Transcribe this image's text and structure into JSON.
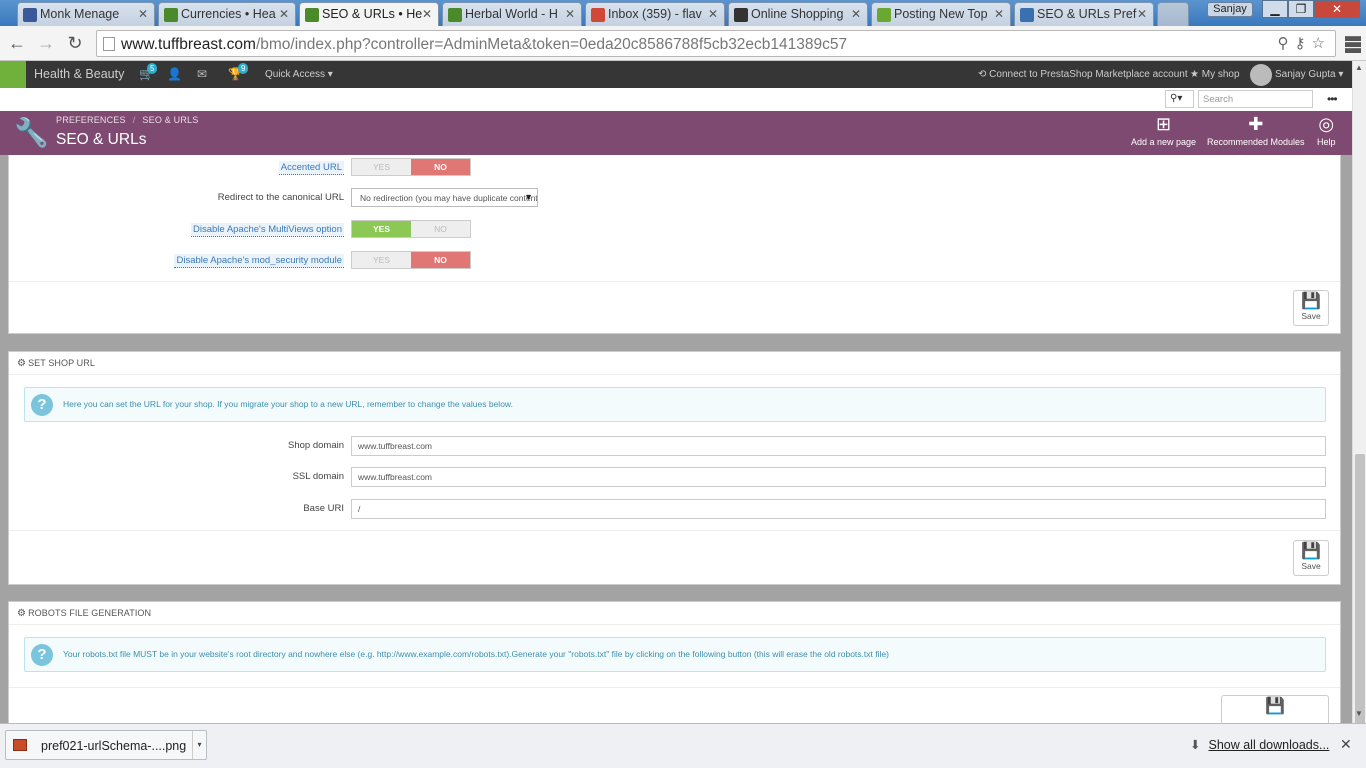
{
  "browser": {
    "tabs": [
      {
        "label": "Monk Menage",
        "icon": "facebook-icon",
        "color": "#3b5998"
      },
      {
        "label": "Currencies • Hea",
        "icon": "leaf-icon",
        "color": "#4a8a2a"
      },
      {
        "label": "SEO & URLs • He",
        "icon": "leaf-icon",
        "color": "#4a8a2a",
        "active": true
      },
      {
        "label": "Herbal World - H",
        "icon": "leaf-icon",
        "color": "#4a8a2a"
      },
      {
        "label": "Inbox (359) - flav",
        "icon": "gmail-icon",
        "color": "#d14836"
      },
      {
        "label": "Online Shopping",
        "icon": "store-icon",
        "color": "#333333"
      },
      {
        "label": "Posting New Top",
        "icon": "forum-icon",
        "color": "#6aa832"
      },
      {
        "label": "SEO & URLs Pref",
        "icon": "prestashop-icon",
        "color": "#3a6fb0"
      }
    ],
    "user": "Sanjay",
    "url_host": "www.tuffbreast.com",
    "url_path": "/bmo/index.php?controller=AdminMeta&token=0eda20c8586788f5cb32ecb141389c57"
  },
  "header": {
    "shop_name": "Health & Beauty",
    "cart_count": "5",
    "trophy_count": "9",
    "quick_access": "Quick Access",
    "marketplace": "Connect to PrestaShop Marketplace account",
    "my_shop": "My shop",
    "employee": "Sanjay Gupta",
    "search_placeholder": "Search"
  },
  "toolbar": {
    "crumb1": "PREFERENCES",
    "crumb2": "SEO & URLS",
    "title": "SEO & URLs",
    "add_page": "Add a new page",
    "recommended": "Recommended Modules",
    "help": "Help"
  },
  "options_panel": {
    "accented_url": "Accented URL",
    "redirect_label": "Redirect to the canonical URL",
    "redirect_value": "No redirection (you may have duplicate content issues)",
    "multiviews": "Disable Apache's MultiViews option",
    "mod_security": "Disable Apache's mod_security module",
    "yes": "YES",
    "no": "NO",
    "save": "Save"
  },
  "shop_url_panel": {
    "heading": "SET SHOP URL",
    "info": "Here you can set the URL for your shop. If you migrate your shop to a new URL, remember to change the values below.",
    "shop_domain_label": "Shop domain",
    "shop_domain": "www.tuffbreast.com",
    "ssl_domain_label": "SSL domain",
    "ssl_domain": "www.tuffbreast.com",
    "base_uri_label": "Base URI",
    "base_uri": "/",
    "save": "Save"
  },
  "robots_panel": {
    "heading": "ROBOTS FILE GENERATION",
    "info": "Your robots.txt file MUST be in your website's root directory and nowhere else (e.g. http://www.example.com/robots.txt).Generate your \"robots.txt\" file by clicking on the following button (this will erase the old robots.txt file)"
  },
  "downloads": {
    "file": "pref021-urlSchema-....png",
    "show_all": "Show all downloads..."
  }
}
